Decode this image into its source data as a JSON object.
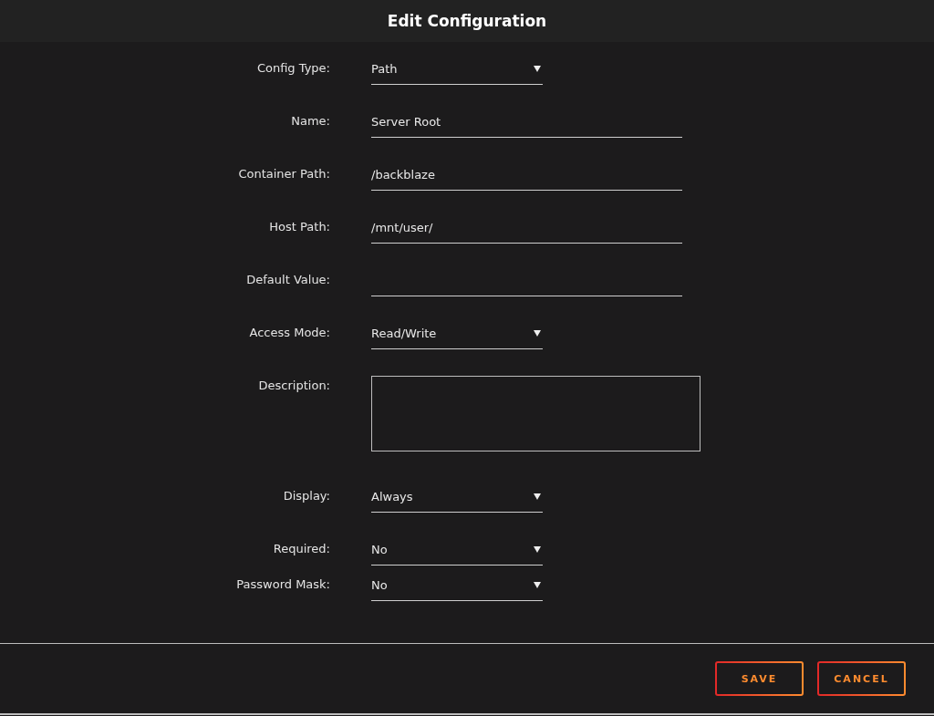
{
  "window": {
    "title": "Edit Configuration"
  },
  "fields": [
    {
      "label": "Config Type:",
      "kind": "select",
      "value": "Path"
    },
    {
      "label": "Name:",
      "kind": "text",
      "value": "Server Root"
    },
    {
      "label": "Container Path:",
      "kind": "text",
      "value": "/backblaze"
    },
    {
      "label": "Host Path:",
      "kind": "text",
      "value": "/mnt/user/"
    },
    {
      "label": "Default Value:",
      "kind": "text"
    },
    {
      "label": "Access Mode:",
      "kind": "select",
      "value": "Read/Write"
    },
    {
      "label": "Description:",
      "kind": "textarea"
    },
    {
      "label": "Display:",
      "kind": "select",
      "value": "Always"
    },
    {
      "label": "Required:",
      "kind": "select",
      "value": "No"
    },
    {
      "label": "Password Mask:",
      "kind": "select",
      "value": "No"
    }
  ],
  "buttons": [
    "SAVE",
    "CANCEL"
  ]
}
